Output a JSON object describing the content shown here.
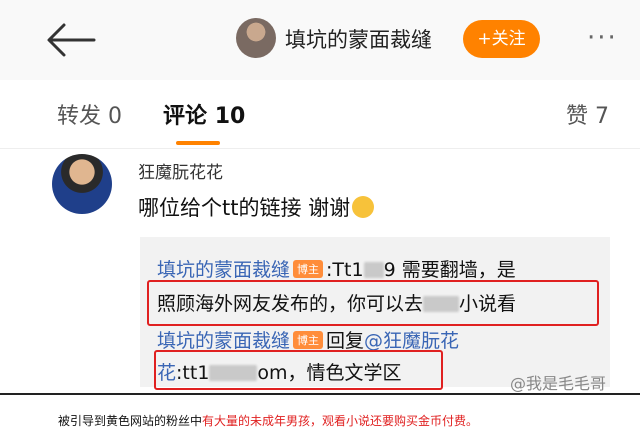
{
  "header": {
    "title": "填坑的蒙面裁缝",
    "follow_label": "+关注",
    "more_label": "···"
  },
  "tabs": [
    {
      "label": "转发",
      "count": "0"
    },
    {
      "label": "评论",
      "count": "10"
    },
    {
      "label": "赞",
      "count": "7"
    }
  ],
  "comment": {
    "user": "狂魔朊花花",
    "text": "哪位给个tt的链接 谢谢"
  },
  "replies": {
    "r1_author": "填坑的蒙面裁缝",
    "badge": "博主",
    "r1_part1": ":Tt1",
    "r1_part2": "9 需要翻墙，是",
    "r1_line2_a": "照顾海外网友发布的，你可以去",
    "r1_line2_b": "小说看",
    "r2_author": "填坑的蒙面裁缝",
    "r2_reply": "回复",
    "r2_mention": "@狂魔朊花",
    "r2_mention_cont": "花",
    "r2_line2_a": ":tt1",
    "r2_line2_b": "om，情色文学区"
  },
  "watermark": "@我是毛毛哥",
  "caption": {
    "part1": "被引导到黄色网站的粉丝中",
    "part2": "有大量的未成年男孩，观看小说还要购买金币付费。"
  }
}
